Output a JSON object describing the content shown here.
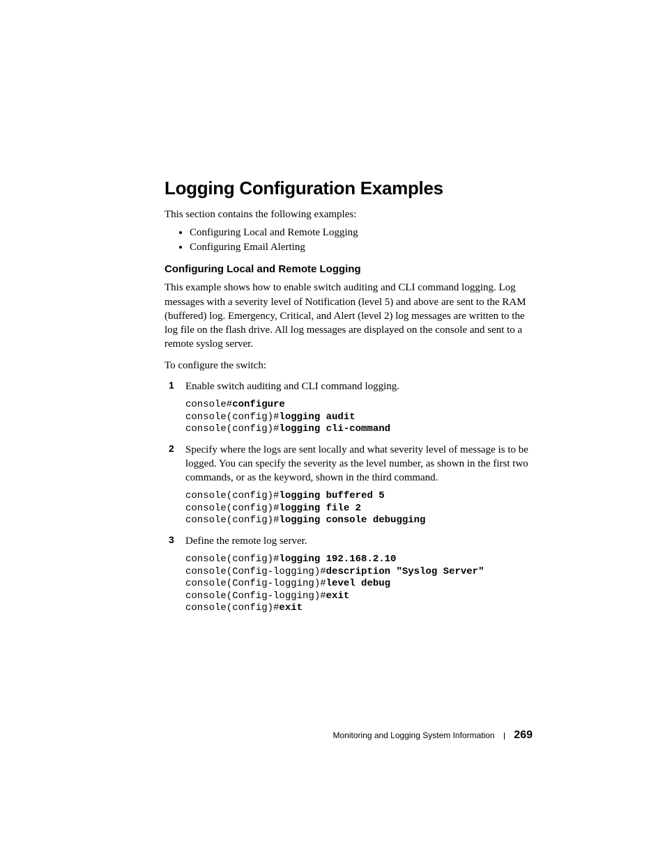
{
  "heading": "Logging Configuration Examples",
  "intro": "This section contains the following examples:",
  "toc": [
    "Configuring Local and Remote Logging",
    "Configuring Email Alerting"
  ],
  "section": {
    "title": "Configuring Local and Remote Logging",
    "para1": "This example shows how to enable switch auditing and CLI command logging. Log messages with a severity level of Notification (level 5) and above are sent to the RAM (buffered) log. Emergency, Critical, and Alert (level 2) log messages are written to the log file on the flash drive. All log messages are displayed on the console and sent to a remote syslog server.",
    "para2": "To configure the switch:"
  },
  "steps": [
    {
      "text": "Enable switch auditing and CLI command logging.",
      "code": [
        {
          "pre": "console#",
          "bold": "configure",
          "post": ""
        },
        {
          "pre": "console(config)#",
          "bold": "logging audit",
          "post": ""
        },
        {
          "pre": "console(config)#",
          "bold": "logging cli-command",
          "post": ""
        }
      ]
    },
    {
      "text": "Specify where the logs are sent locally and what severity level of message is to be logged. You can specify the severity as the level number, as shown in the first two commands, or as the keyword, shown in the third command.",
      "code": [
        {
          "pre": "console(config)#",
          "bold": "logging buffered 5",
          "post": ""
        },
        {
          "pre": "console(config)#",
          "bold": "logging file 2",
          "post": ""
        },
        {
          "pre": "console(config)#",
          "bold": "logging console debugging",
          "post": ""
        }
      ]
    },
    {
      "text": "Define the remote log server.",
      "code": [
        {
          "pre": "console(config)#",
          "bold": "logging 192.168.2.10",
          "post": ""
        },
        {
          "pre": "console(Config-logging)#",
          "bold": "description \"Syslog Server\"",
          "post": ""
        },
        {
          "pre": "console(Config-logging)#",
          "bold": "level debug",
          "post": ""
        },
        {
          "pre": "console(Config-logging)#",
          "bold": "exit",
          "post": ""
        },
        {
          "pre": "console(config)#",
          "bold": "exit",
          "post": ""
        }
      ]
    }
  ],
  "footer": {
    "chapter": "Monitoring and Logging System Information",
    "page": "269"
  }
}
